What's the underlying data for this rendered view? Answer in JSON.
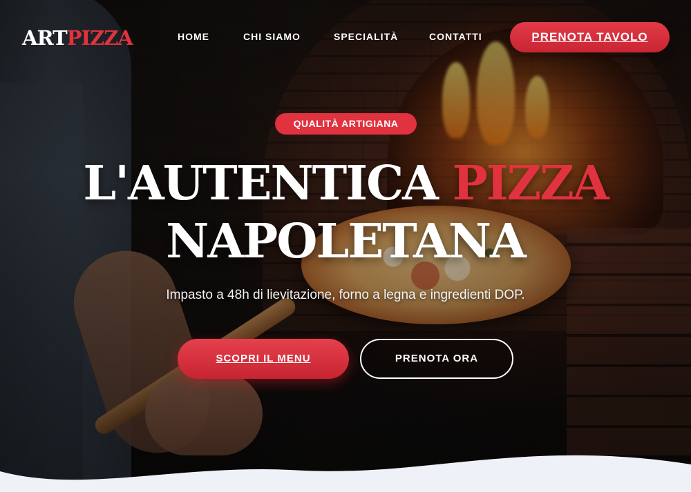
{
  "brand": {
    "logo_main": "ART",
    "logo_accent": "PIZZA",
    "accent_color": "#e0323f"
  },
  "nav": {
    "items": [
      {
        "label": "HOME"
      },
      {
        "label": "CHI SIAMO"
      },
      {
        "label": "SPECIALITÀ"
      },
      {
        "label": "CONTATTI"
      }
    ],
    "cta_label": "PRENOTA TAVOLO"
  },
  "hero": {
    "badge": "QUALITÀ ARTIGIANA",
    "headline_line1_main": "L'AUTENTICA ",
    "headline_line1_accent": "PIZZA",
    "headline_line2": "NAPOLETANA",
    "subtitle": "Impasto a 48h di lievitazione, forno a legna e ingredienti DOP.",
    "primary_button": "SCOPRI IL MENU",
    "secondary_button": "PRENOTA ORA",
    "background_image": "chef-with-pizza-peel-at-wood-fired-oven"
  }
}
